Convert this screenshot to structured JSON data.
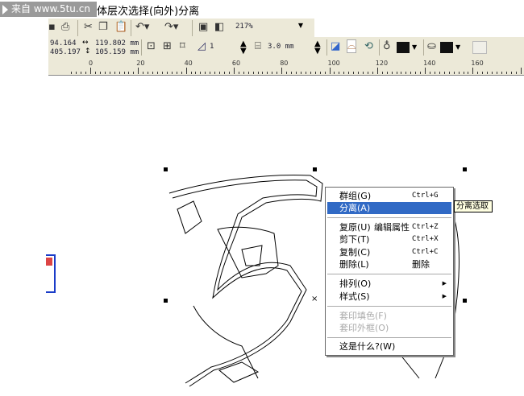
{
  "title": "体层次选择(向外)分离",
  "watermark": "来自 www.5tu.cn",
  "toolbar": {
    "zoom": "217%",
    "x": "94.164",
    "y": "405.197",
    "width": "119.802 mm",
    "height": "105.159 mm",
    "angle": "1",
    "outline_width": "3.0 mm"
  },
  "ruler": {
    "labels": [
      "0",
      "20",
      "40",
      "60",
      "80",
      "100",
      "120",
      "140",
      "160"
    ]
  },
  "menu": {
    "items": [
      {
        "label": "群组(G)",
        "shortcut": "Ctrl+G"
      },
      {
        "label": "分离(A)"
      },
      {
        "label": "复原(U)",
        "extra": "编辑属性",
        "shortcut": "Ctrl+Z"
      },
      {
        "label": "剪下(T)",
        "shortcut": "Ctrl+X"
      },
      {
        "label": "复制(C)",
        "shortcut": "Ctrl+C"
      },
      {
        "label": "删除(L)",
        "shortcut": "删除"
      },
      {
        "label": "排列(O)"
      },
      {
        "label": "样式(S)"
      },
      {
        "label": "套印填色(F)"
      },
      {
        "label": "套印外框(O)"
      },
      {
        "label": "这是什么?(W)"
      }
    ]
  },
  "tooltip": "分离选取",
  "colors": {
    "highlight": "#316ac5",
    "toolbar": "#ece9d8"
  }
}
